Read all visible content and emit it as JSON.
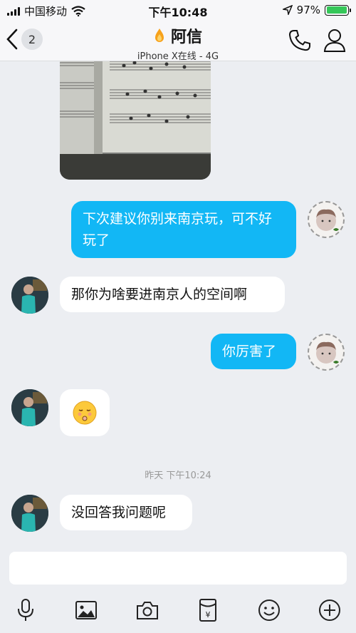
{
  "status_bar": {
    "carrier": "中国移动",
    "time": "下午10:48",
    "battery": "97%",
    "battery_level": 0.97
  },
  "nav": {
    "back_count": "2",
    "title": "阿信",
    "subtitle": "iPhone X在线 - 4G"
  },
  "messages": {
    "m1": "下次建议你别来南京玩，可不好玩了",
    "m2": "那你为啥要进南京人的空间啊",
    "m3": "你厉害了",
    "m5": "没回答我问题呢"
  },
  "timestamp": "昨天 下午10:24",
  "colors": {
    "sent_bubble": "#12b7f5",
    "received_bubble": "#ffffff",
    "background": "#eceef2",
    "battery": "#35c759"
  },
  "toolbar_icons": [
    "microphone-icon",
    "image-icon",
    "camera-icon",
    "red-packet-icon",
    "emoji-icon",
    "plus-icon"
  ]
}
